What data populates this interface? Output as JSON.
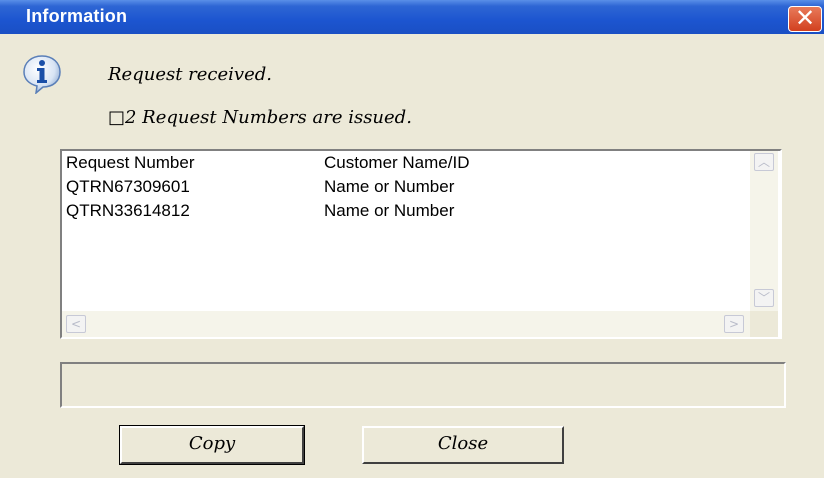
{
  "window": {
    "title": "Information",
    "close_glyph": "✕"
  },
  "message": {
    "icon": "info-icon",
    "line1": "Request received.",
    "line2": "□2 Request Numbers are issued."
  },
  "list": {
    "header": {
      "col1": "Request Number",
      "col2": "Customer Name/ID"
    },
    "rows": [
      {
        "col1": "QTRN67309601",
        "col2": "Name or Number"
      },
      {
        "col1": "QTRN33614812",
        "col2": "Name or Number"
      }
    ]
  },
  "scroll": {
    "up": "︿",
    "down": "﹀",
    "left": "<",
    "right": ">"
  },
  "buttons": {
    "copy": "Copy",
    "close": "Close"
  },
  "status_field": {
    "value": ""
  },
  "colors": {
    "title_bar": "#1C55D0",
    "dialog_bg": "#ECE9D8",
    "close_button": "#D2401F"
  }
}
